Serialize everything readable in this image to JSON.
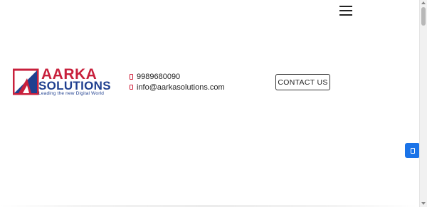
{
  "header": {
    "menu_icon": "hamburger-menu-icon"
  },
  "logo": {
    "brand_top": "AARKA",
    "brand_bottom": "SOLUTIONS",
    "tagline": "Leading the new Digital World",
    "colors": {
      "red": "#c8203c",
      "blue": "#1f3f8f"
    }
  },
  "contact": {
    "phone": "9989680090",
    "email": "info@aarkasolutions.com",
    "phone_icon": "mobile-phone-icon",
    "email_icon": "mobile-phone-icon"
  },
  "cta": {
    "label": "CONTACT US"
  },
  "floating_button": {
    "icon": "mobile-phone-icon",
    "color": "#1a73e8"
  }
}
